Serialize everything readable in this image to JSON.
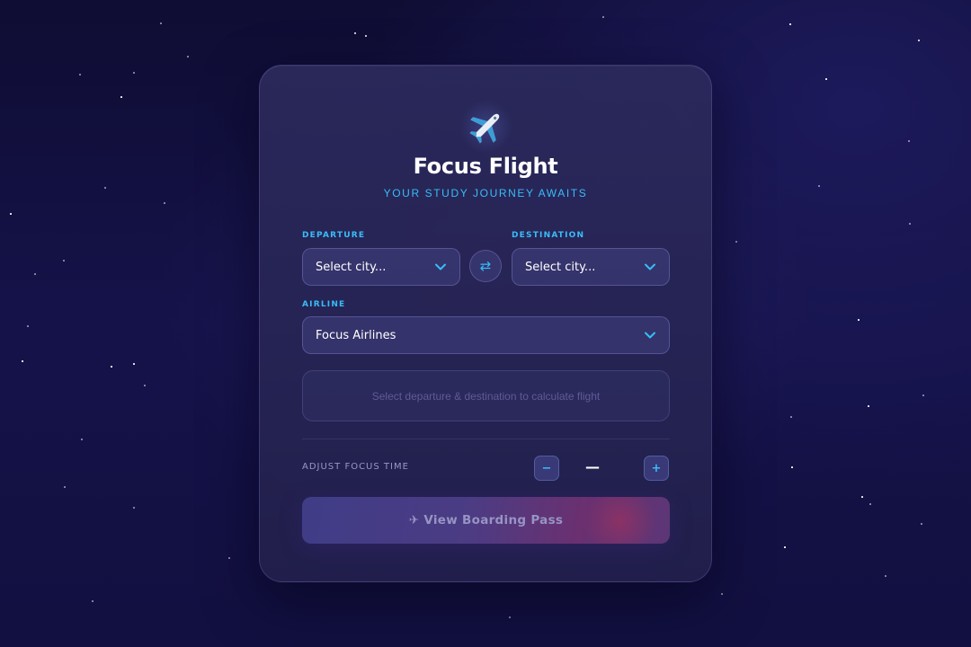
{
  "header": {
    "icon": "airplane-icon",
    "title": "Focus Flight",
    "subtitle": "YOUR STUDY JOURNEY AWAITS"
  },
  "departure": {
    "label": "DEPARTURE",
    "value": "Select city..."
  },
  "destination": {
    "label": "DESTINATION",
    "value": "Select city..."
  },
  "swap": {
    "icon": "swap-arrows-icon",
    "glyph": "⇄"
  },
  "airline": {
    "label": "AIRLINE",
    "value": "Focus Airlines"
  },
  "info": {
    "message": "Select departure & destination to calculate flight"
  },
  "focus_time": {
    "label": "ADJUST FOCUS TIME",
    "decrement": "−",
    "increment": "+",
    "value": "—"
  },
  "boarding": {
    "label": "✈ View Boarding Pass"
  },
  "colors": {
    "accent": "#38bdf8",
    "background": "#15124a",
    "card": "#2a2858"
  }
}
